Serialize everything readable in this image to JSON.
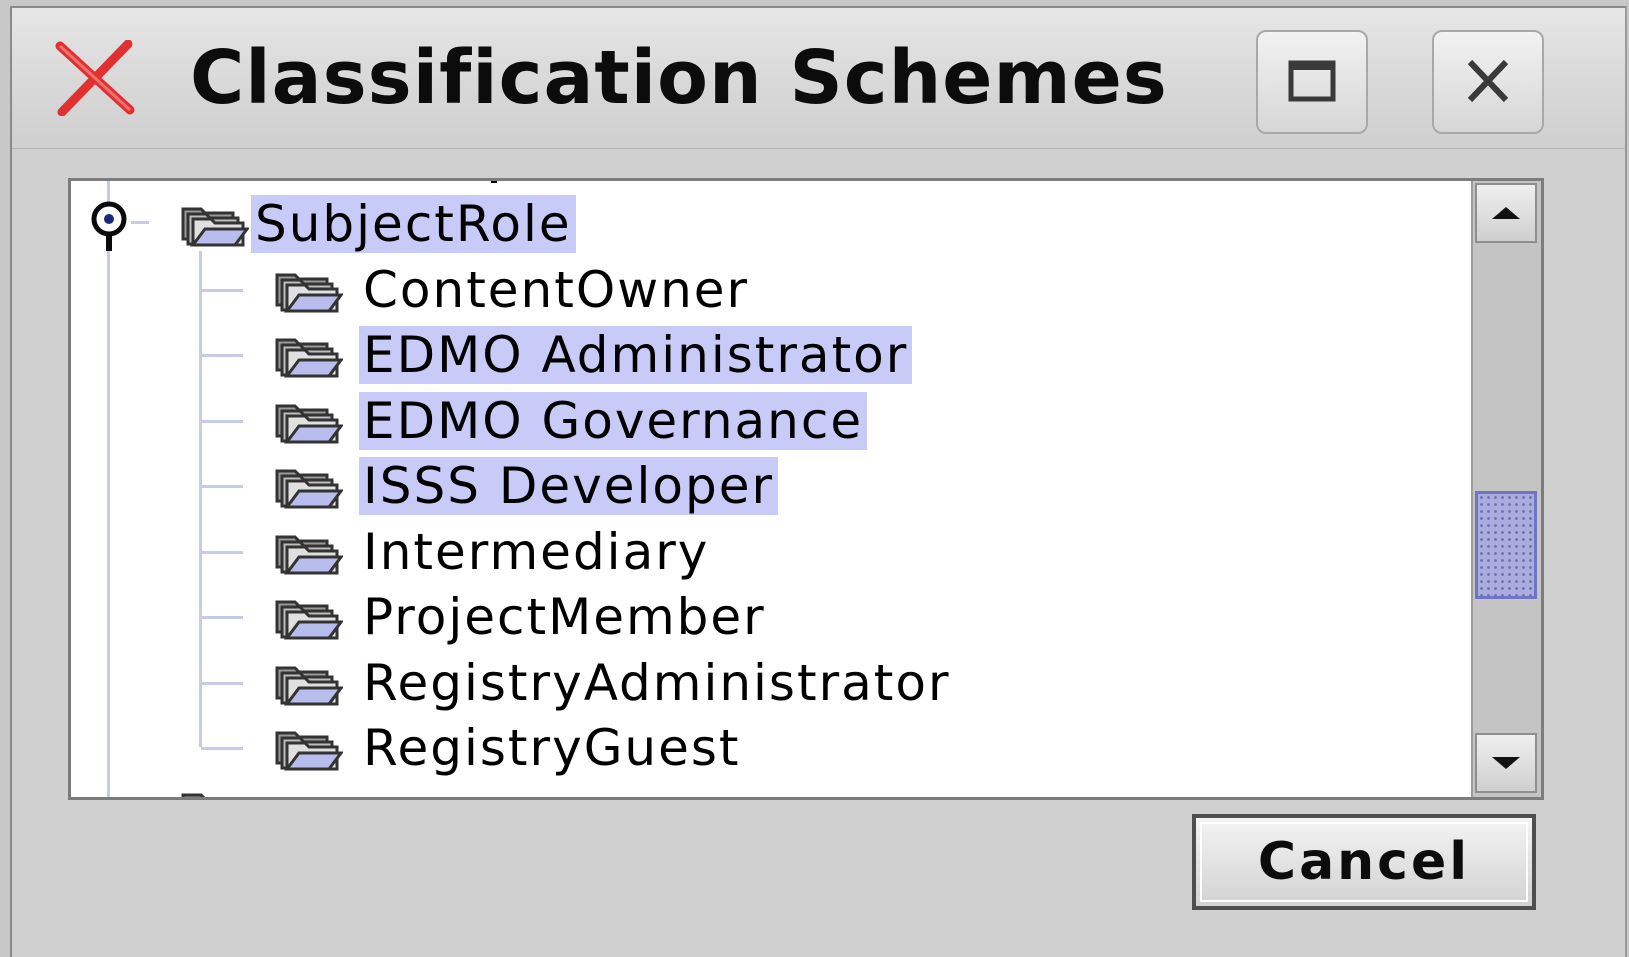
{
  "window": {
    "title": "Classification Schemes",
    "app_icon": "red-x-icon",
    "maximize_icon": "maximize-icon",
    "close_icon": "close-icon"
  },
  "tree": {
    "parent": {
      "label": "SubjectRole",
      "selected": true,
      "expanded": true,
      "icon": "open-folders-icon"
    },
    "children": [
      {
        "label": "ContentOwner",
        "selected": false,
        "icon": "open-folders-icon"
      },
      {
        "label": "EDMO Administrator",
        "selected": true,
        "icon": "open-folders-icon"
      },
      {
        "label": "EDMO Governance",
        "selected": true,
        "icon": "open-folders-icon"
      },
      {
        "label": "ISSS Developer",
        "selected": true,
        "icon": "open-folders-icon"
      },
      {
        "label": "Intermediary",
        "selected": false,
        "icon": "open-folders-icon"
      },
      {
        "label": "ProjectMember",
        "selected": false,
        "icon": "open-folders-icon"
      },
      {
        "label": "RegistryAdministrator",
        "selected": false,
        "icon": "open-folders-icon"
      },
      {
        "label": "RegistryGuest",
        "selected": false,
        "icon": "open-folders-icon"
      }
    ]
  },
  "buttons": {
    "cancel": "Cancel"
  },
  "colors": {
    "selection": "#c8caf7",
    "tree_lines": "#c6cbe8",
    "scroll_thumb": "#a9acdc",
    "app_icon_red": "#e03030"
  }
}
